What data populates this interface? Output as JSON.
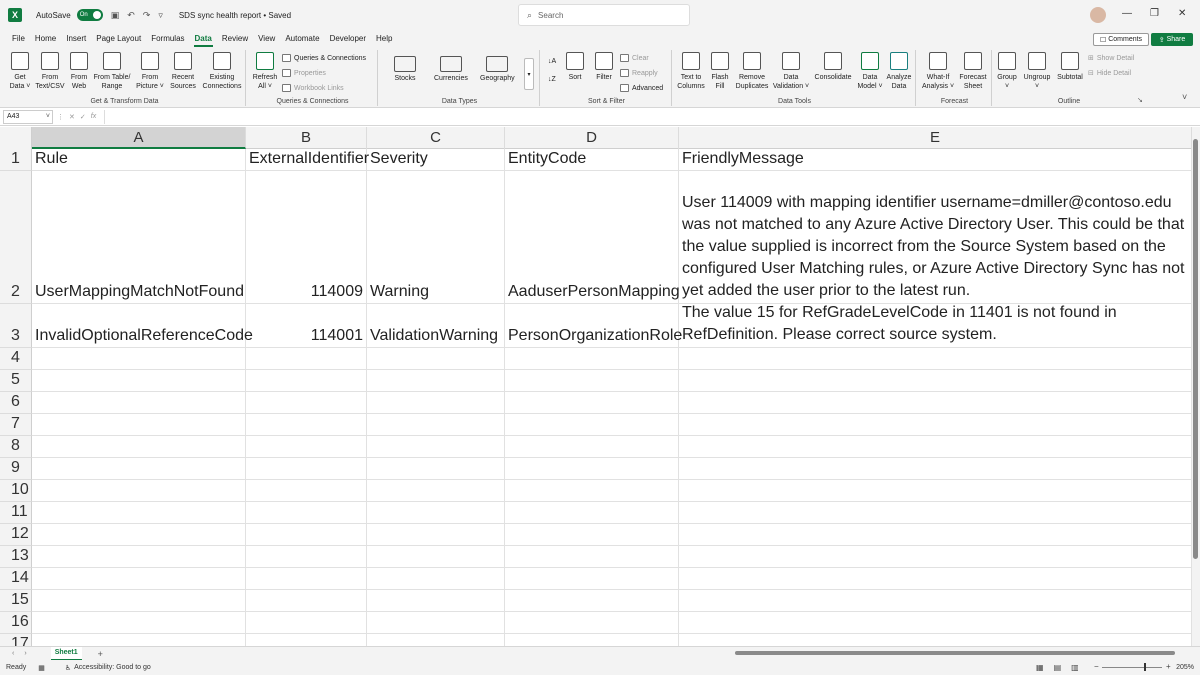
{
  "titlebar": {
    "autosave_label": "AutoSave",
    "toggle_label": "On",
    "doc_title": "SDS sync health report • Saved",
    "search_placeholder": "Search",
    "minimize": "—",
    "restore": "❐",
    "close": "✕"
  },
  "tabs": [
    "File",
    "Home",
    "Insert",
    "Page Layout",
    "Formulas",
    "Data",
    "Review",
    "View",
    "Automate",
    "Developer",
    "Help"
  ],
  "active_tab": "Data",
  "comments_label": "Comments",
  "share_label": "Share",
  "ribbon": {
    "get_transform": {
      "label": "Get & Transform Data",
      "buttons": [
        {
          "l1": "Get",
          "l2": "Data ˅"
        },
        {
          "l1": "From",
          "l2": "Text/CSV"
        },
        {
          "l1": "From",
          "l2": "Web"
        },
        {
          "l1": "From Table/",
          "l2": "Range"
        },
        {
          "l1": "From",
          "l2": "Picture ˅"
        },
        {
          "l1": "Recent",
          "l2": "Sources"
        },
        {
          "l1": "Existing",
          "l2": "Connections"
        }
      ]
    },
    "queries": {
      "label": "Queries & Connections",
      "refresh": {
        "l1": "Refresh",
        "l2": "All ˅"
      },
      "items": [
        "Queries & Connections",
        "Properties",
        "Workbook Links"
      ]
    },
    "data_types": {
      "label": "Data Types",
      "buttons": [
        "Stocks",
        "Currencies",
        "Geography"
      ]
    },
    "sort_filter": {
      "label": "Sort & Filter",
      "sort": "Sort",
      "filter": "Filter",
      "clear": "Clear",
      "reapply": "Reapply",
      "advanced": "Advanced"
    },
    "data_tools": {
      "label": "Data Tools",
      "buttons": [
        {
          "l1": "Text to",
          "l2": "Columns"
        },
        {
          "l1": "Flash",
          "l2": "Fill"
        },
        {
          "l1": "Remove",
          "l2": "Duplicates"
        },
        {
          "l1": "Data",
          "l2": "Validation ˅"
        },
        {
          "l1": "Consolidate",
          "l2": ""
        },
        {
          "l1": "Data",
          "l2": "Model ˅"
        },
        {
          "l1": "Analyze",
          "l2": "Data"
        }
      ]
    },
    "forecast": {
      "label": "Forecast",
      "buttons": [
        {
          "l1": "What-If",
          "l2": "Analysis ˅"
        },
        {
          "l1": "Forecast",
          "l2": "Sheet"
        }
      ]
    },
    "outline": {
      "label": "Outline",
      "buttons": [
        {
          "l1": "Group",
          "l2": "˅"
        },
        {
          "l1": "Ungroup",
          "l2": "˅"
        },
        {
          "l1": "Subtotal",
          "l2": ""
        }
      ],
      "show_detail": "Show Detail",
      "hide_detail": "Hide Detail"
    }
  },
  "formula_bar": {
    "name_box": "A43",
    "fx": "fx"
  },
  "columns": [
    "A",
    "B",
    "C",
    "D",
    "E"
  ],
  "rows": [
    {
      "num": "1",
      "cells": [
        "Rule",
        "ExternalIdentifier",
        "Severity",
        "EntityCode",
        "FriendlyMessage"
      ]
    },
    {
      "num": "2",
      "cells": [
        "UserMappingMatchNotFound",
        "114009",
        "Warning",
        "AaduserPersonMapping",
        "User 114009 with mapping identifier username=dmiller@contoso.edu was not matched to any Azure Active Directory User. This could be that the value supplied is incorrect from the Source System based on the configured User Matching rules, or Azure Active Directory Sync has not yet added the user prior to the latest run."
      ]
    },
    {
      "num": "3",
      "cells": [
        "InvalidOptionalReferenceCode",
        "114001",
        "ValidationWarning",
        "PersonOrganizationRole",
        "The value 15 for RefGradeLevelCode in 11401 is not found in RefDefinition. Please correct source system."
      ]
    }
  ],
  "empty_rows": [
    "4",
    "5",
    "6",
    "7",
    "8",
    "9",
    "10",
    "11",
    "12",
    "13",
    "14",
    "15",
    "16",
    "17"
  ],
  "sheet": {
    "tab_name": "Sheet1",
    "add": "+"
  },
  "status": {
    "ready": "Ready",
    "accessibility": "Accessibility: Good to go",
    "zoom": "205%"
  }
}
